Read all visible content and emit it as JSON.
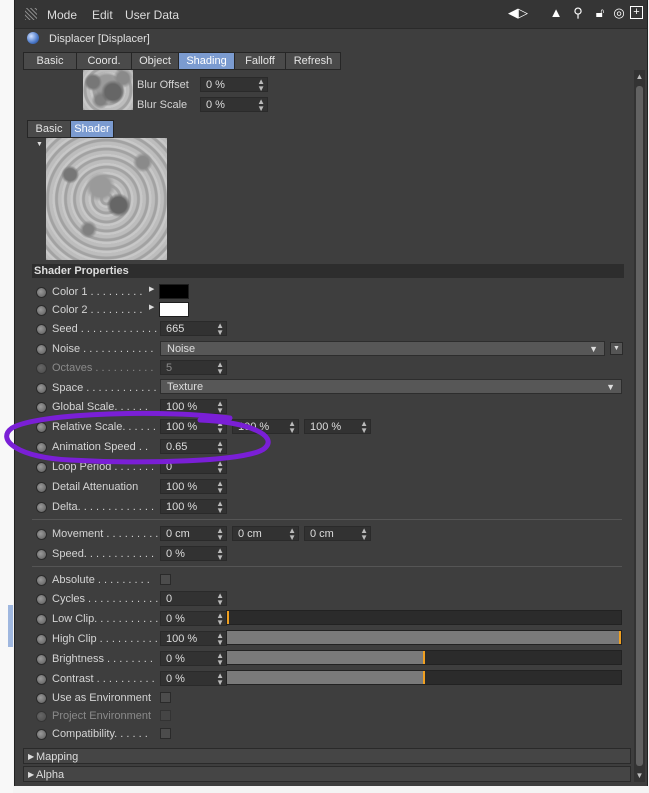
{
  "menu": {
    "mode": "Mode",
    "edit": "Edit",
    "user_data": "User Data"
  },
  "title": "Displacer [Displacer]",
  "main_tabs": [
    {
      "label": "Basic"
    },
    {
      "label": "Coord."
    },
    {
      "label": "Object"
    },
    {
      "label": "Shading",
      "active": true
    },
    {
      "label": "Falloff"
    },
    {
      "label": "Refresh"
    }
  ],
  "blur": {
    "offset_label": "Blur Offset",
    "offset_value": "0 %",
    "scale_label": "Blur Scale",
    "scale_value": "0 %"
  },
  "sub_tabs": [
    {
      "label": "Basic"
    },
    {
      "label": "Shader",
      "active": true
    }
  ],
  "shader_properties": {
    "header": "Shader Properties",
    "color1_label": "Color 1 . . . . . . . . .",
    "color1": "#000000",
    "color2_label": "Color 2 . . . . . . . . .",
    "color2": "#ffffff",
    "seed_label": "Seed . . . . . . . . . . . . .",
    "seed": "665",
    "noise_label": "Noise . . . . . . . . . . . .",
    "noise": "Noise",
    "octaves_label": "Octaves . . . . . . . . . .",
    "octaves": "5",
    "space_label": "Space . . . . . . . . . . . .",
    "space": "Texture",
    "global_scale_label": "Global Scale. . . . . .",
    "global_scale": "100 %",
    "relative_scale_label": "Relative Scale. . . . . .",
    "relative_scale": [
      "100 %",
      "100 %",
      "100 %"
    ],
    "animation_speed_label": "Animation Speed . .",
    "animation_speed": "0.65",
    "loop_period_label": "Loop Period . . . . . . .",
    "loop_period": "0",
    "detail_attenuation_label": "Detail Attenuation",
    "detail_attenuation": "100 %",
    "delta_label": "Delta. . . . . . . . . . . . .",
    "delta": "100 %",
    "movement_label": "Movement . . . . . . . . .",
    "movement": [
      "0 cm",
      "0 cm",
      "0 cm"
    ],
    "speed_label": "Speed. . . . . . . . . . . .",
    "speed": "0 %",
    "absolute_label": "Absolute . . . . . . . . .",
    "cycles_label": "Cycles . . . . . . . . . . . .",
    "cycles": "0",
    "low_clip_label": "Low Clip. . . . . . . . . . .",
    "low_clip": "0 %",
    "low_clip_fill": 0.0,
    "high_clip_label": "High Clip . . . . . . . . . .",
    "high_clip": "100 %",
    "high_clip_fill": 1.0,
    "brightness_label": "Brightness . . . . . . . .",
    "brightness": "0 %",
    "brightness_fill": 0.5,
    "contrast_label": "Contrast . . . . . . . . . .",
    "contrast": "0 %",
    "contrast_fill": 0.5,
    "use_as_env_label": "Use as Environment",
    "project_env_label": "Project Environment",
    "compatibility_label": "Compatibility. . . . . ."
  },
  "collapsed_sections": [
    {
      "label": "Mapping"
    },
    {
      "label": "Alpha"
    }
  ],
  "colors": {
    "accent_tab": "#7b9bd0",
    "annotation": "#7a1fd6",
    "slider_knob": "#f0a020"
  }
}
